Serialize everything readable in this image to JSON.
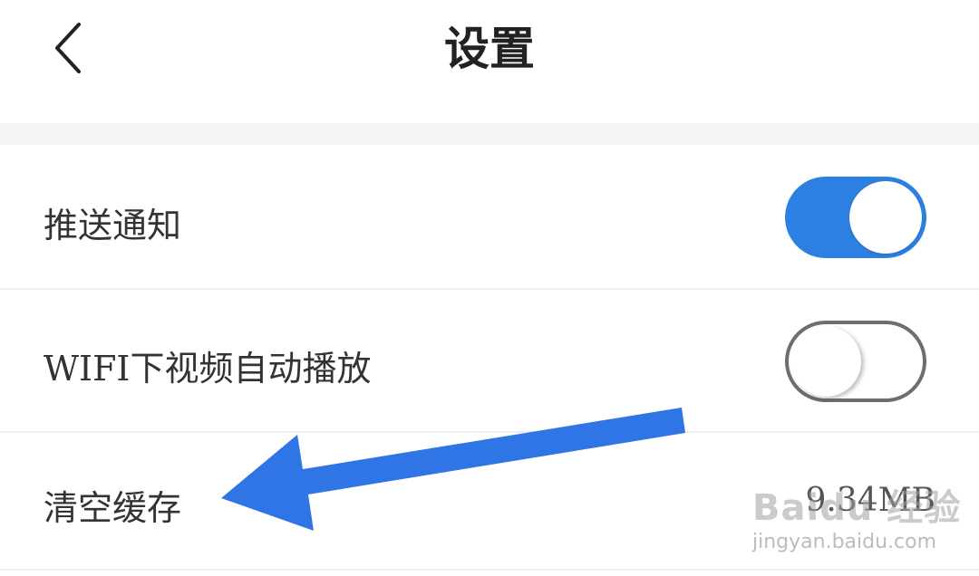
{
  "header": {
    "title": "设置",
    "back_icon": "chevron-left-icon"
  },
  "settings": [
    {
      "label": "推送通知",
      "toggle_on": true
    },
    {
      "label": "WIFI下视频自动播放",
      "toggle_on": false
    },
    {
      "label": "清空缓存",
      "value": "9.34MB"
    }
  ],
  "colors": {
    "accent": "#2d80e1",
    "annotation_arrow": "#2f75e6"
  },
  "watermark": {
    "brand": "Baidu 经验",
    "site": "jingyan.baidu.com"
  }
}
